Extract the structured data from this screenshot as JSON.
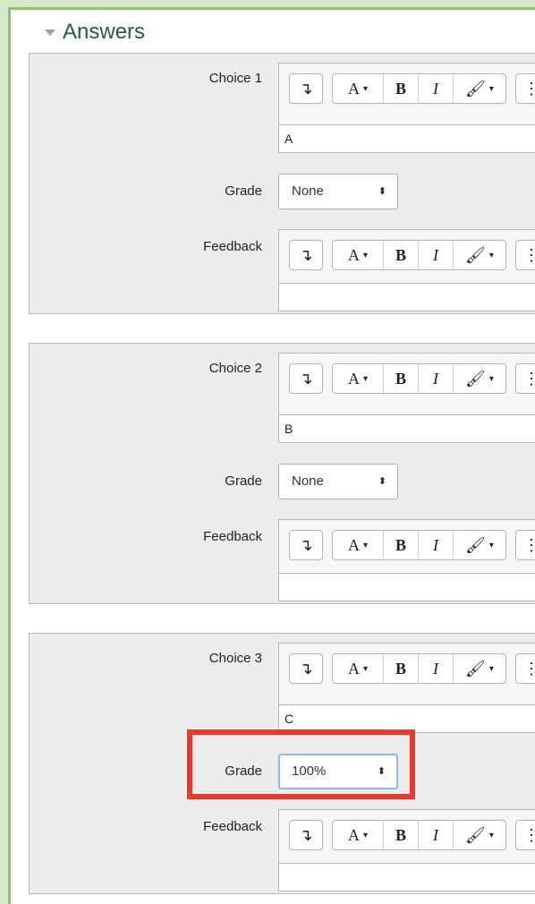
{
  "section": {
    "title": "Answers"
  },
  "labels": {
    "grade": "Grade",
    "feedback": "Feedback"
  },
  "toolbar": {
    "indent_icon": "↴",
    "font_color_label": "A",
    "bold_label": "B",
    "italic_label": "I",
    "dropdown_caret": "▾",
    "more_icon": "⋮"
  },
  "answers": [
    {
      "choice_label": "Choice 1",
      "choice_text": "A",
      "grade": "None",
      "feedback_text": ""
    },
    {
      "choice_label": "Choice 2",
      "choice_text": "B",
      "grade": "None",
      "feedback_text": ""
    },
    {
      "choice_label": "Choice 3",
      "choice_text": "C",
      "grade": "100%",
      "feedback_text": ""
    }
  ],
  "colors": {
    "heading": "#1f5f3a",
    "frame_border": "#8ec07a",
    "highlight_box": "#e8392a",
    "focus_ring": "#8fb8e8"
  }
}
